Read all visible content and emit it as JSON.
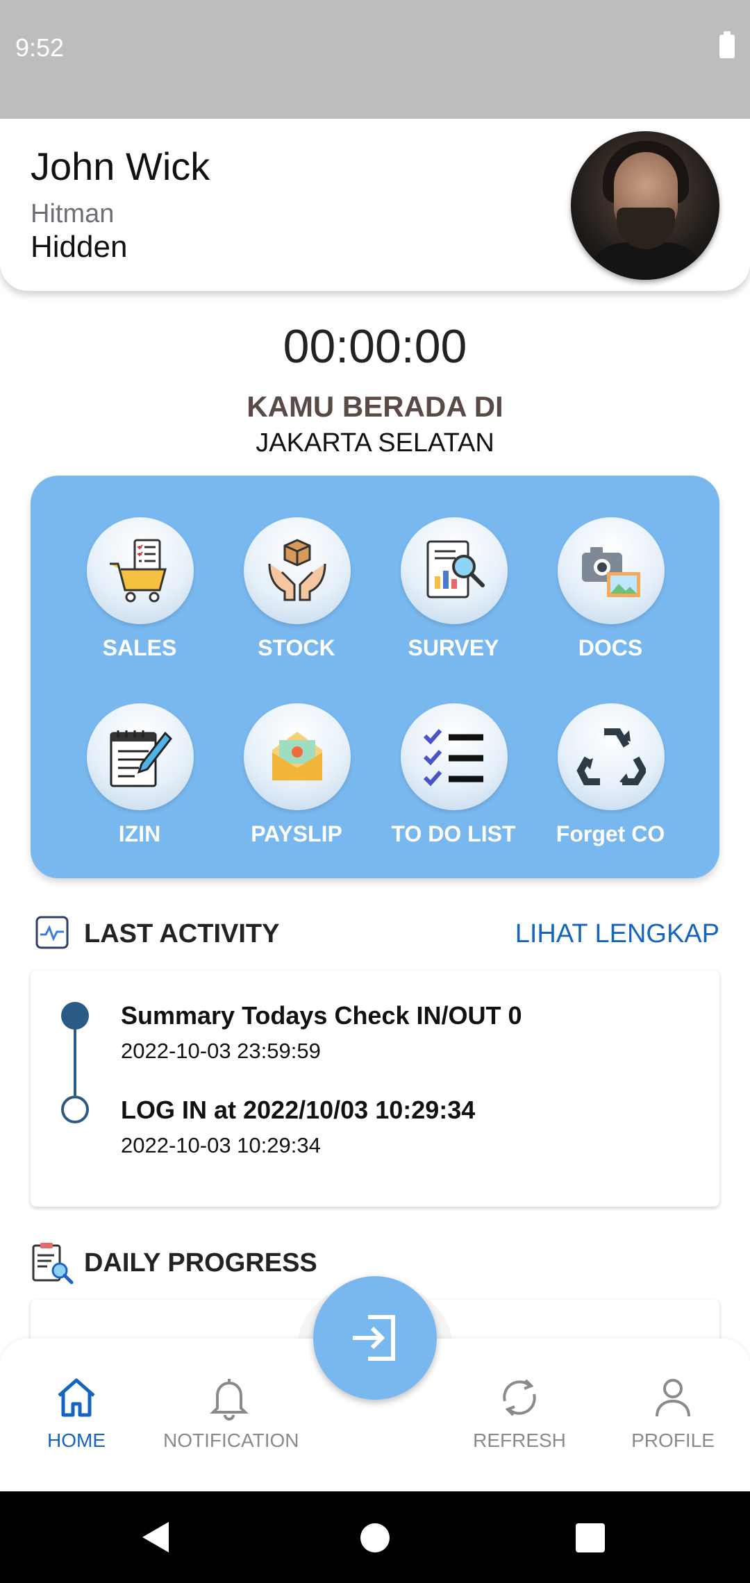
{
  "status_bar": {
    "time": "9:52"
  },
  "profile": {
    "name": "John Wick",
    "role": "Hitman",
    "location": "Hidden"
  },
  "timer": "00:00:00",
  "location_title": "KAMU BERADA DI",
  "location_city": "JAKARTA SELATAN",
  "menu": {
    "items": [
      {
        "label": "SALES",
        "icon": "shopping-cart-icon"
      },
      {
        "label": "STOCK",
        "icon": "box-hands-icon"
      },
      {
        "label": "SURVEY",
        "icon": "survey-report-icon"
      },
      {
        "label": "DOCS",
        "icon": "camera-photo-icon"
      },
      {
        "label": "IZIN",
        "icon": "notepad-pencil-icon"
      },
      {
        "label": "PAYSLIP",
        "icon": "envelope-money-icon"
      },
      {
        "label": "TO DO LIST",
        "icon": "checklist-icon"
      },
      {
        "label": "Forget CO",
        "icon": "recycle-icon"
      }
    ]
  },
  "last_activity": {
    "title": "LAST ACTIVITY",
    "link": "LIHAT LENGKAP",
    "entries": [
      {
        "title": "Summary Todays Check IN/OUT 0",
        "time": "2022-10-03 23:59:59"
      },
      {
        "title": "LOG IN at 2022/10/03 10:29:34",
        "time": "2022-10-03 10:29:34"
      }
    ]
  },
  "daily_progress": {
    "title": "DAILY PROGRESS"
  },
  "bottom_nav": {
    "home": "HOME",
    "notification": "NOTIFICATION",
    "refresh": "REFRESH",
    "profile": "PROFILE"
  },
  "colors": {
    "accent": "#78b8ef",
    "link": "#1565c0",
    "timeline": "#2b5a86"
  }
}
